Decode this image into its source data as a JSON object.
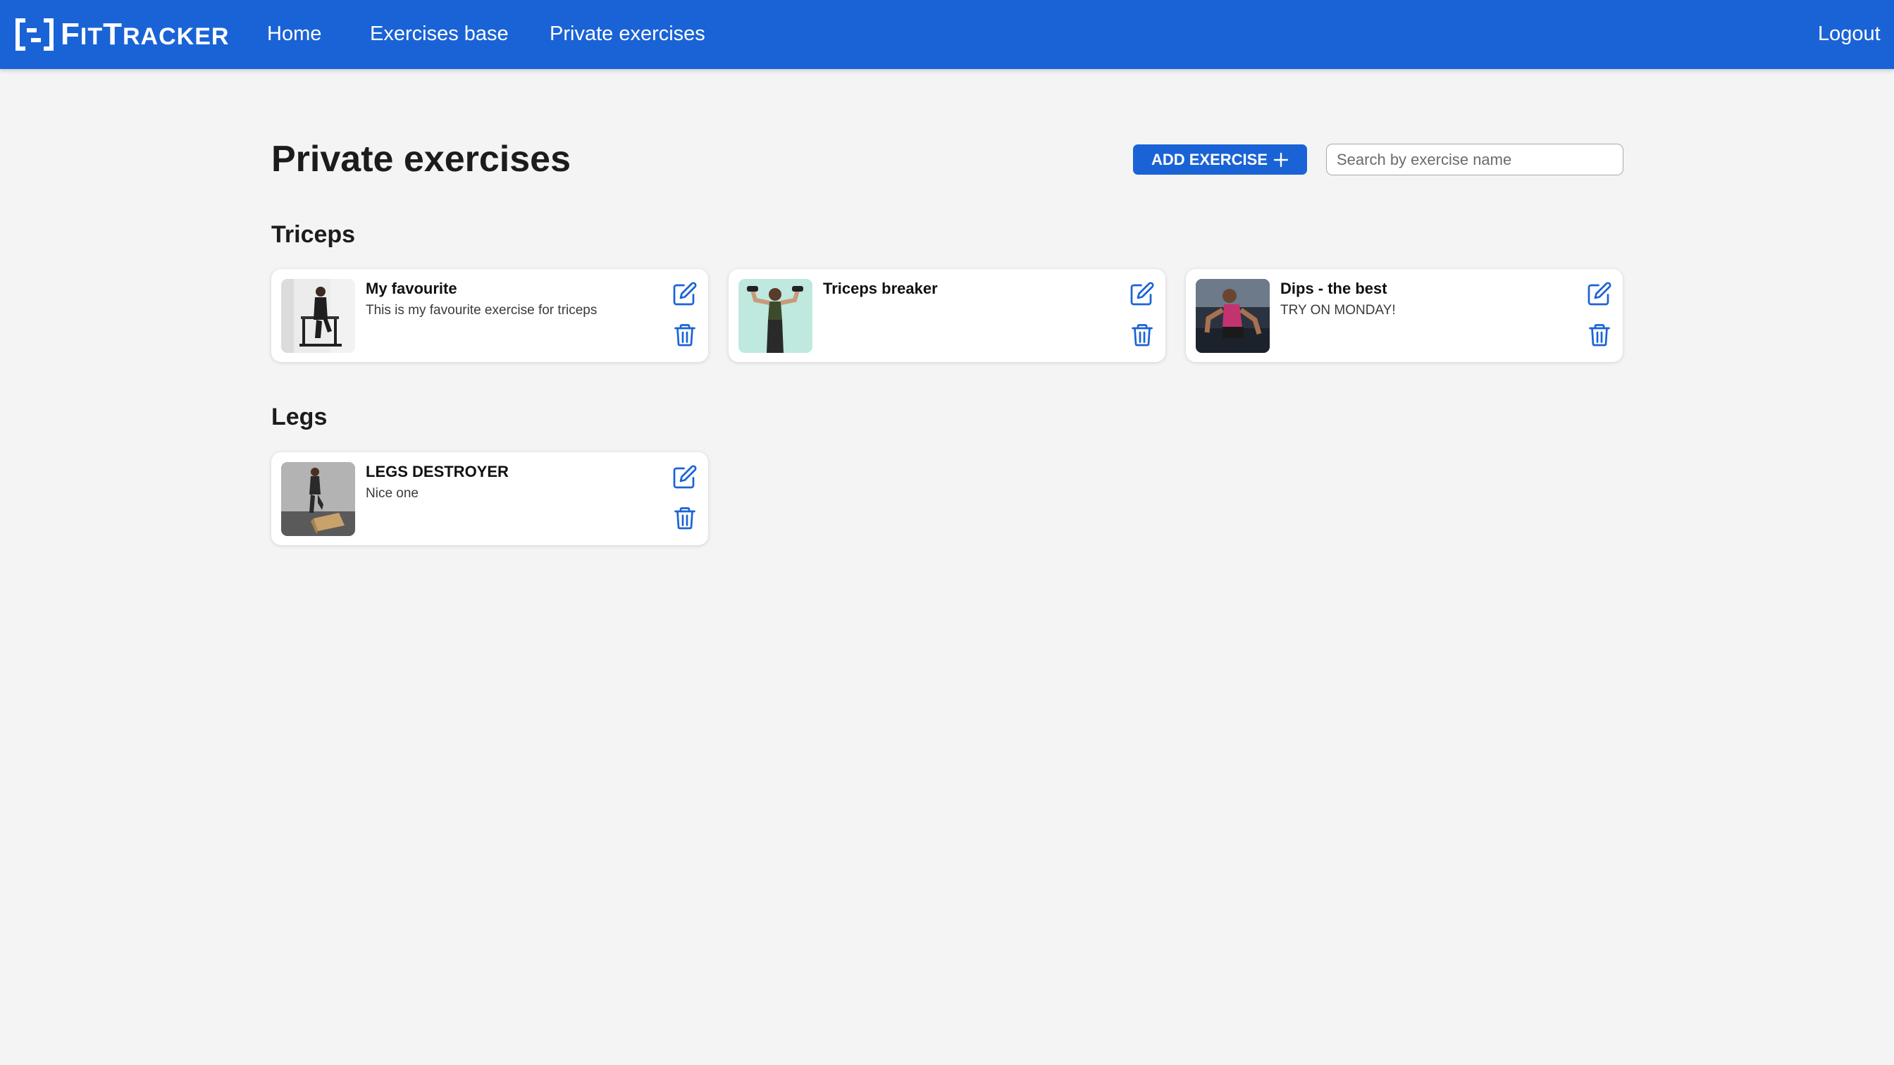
{
  "navbar": {
    "logo_text_big1": "F",
    "logo_text_small1": "IT",
    "logo_text_big2": "T",
    "logo_text_small2": "RACKER",
    "links": [
      "Home",
      "Exercises base",
      "Private exercises"
    ],
    "logout_label": "Logout"
  },
  "page": {
    "title": "Private exercises",
    "add_button_label": "ADD EXERCISE",
    "search_placeholder": "Search by exercise name",
    "search_value": ""
  },
  "sections": [
    {
      "title": "Triceps",
      "exercises": [
        {
          "name": "My favourite",
          "description": "This is my favourite exercise for triceps",
          "image": "photo of man on dip bars"
        },
        {
          "name": "Triceps breaker",
          "description": "",
          "image": "photo of woman with dumbbells"
        },
        {
          "name": "Dips - the best",
          "description": "TRY ON MONDAY!",
          "image": "photo of woman doing dips"
        }
      ]
    },
    {
      "title": "Legs",
      "exercises": [
        {
          "name": "LEGS DESTROYER",
          "description": "Nice one",
          "image": "photo of man on plyo box"
        }
      ]
    }
  ],
  "icons": {
    "edit": "edit-icon",
    "delete": "trash-icon",
    "add": "plus-icon"
  },
  "colors": {
    "primary": "#1a63d6",
    "background": "#f4f4f4",
    "card": "#ffffff"
  }
}
